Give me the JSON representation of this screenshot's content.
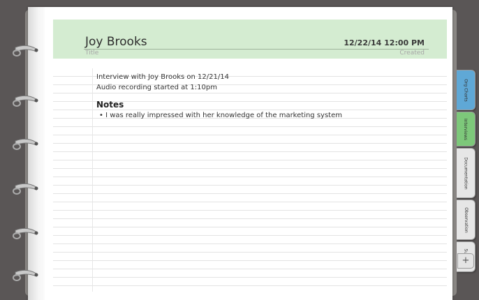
{
  "note": {
    "title": "Joy Brooks",
    "title_caption": "Title",
    "created": "12/22/14 12:00 PM",
    "created_caption": "Created"
  },
  "body": {
    "line1": "Interview with Joy Brooks on 12/21/14",
    "line2": "Audio recording started at 1:10pm",
    "heading": "Notes",
    "bullet1": "•  I was really impressed with her knowledge of the marketing system"
  },
  "tabs": [
    {
      "label": "Org Charts",
      "color": "#5fa8d6"
    },
    {
      "label": "Interviews",
      "color": "#7dc87a"
    },
    {
      "label": "Documentation",
      "color": "#e6e6e6"
    },
    {
      "label": "Observation",
      "color": "#e6e6e6"
    },
    {
      "label": "Surveys",
      "color": "#e6e6e6"
    }
  ],
  "add_tab_label": "+",
  "colors": {
    "header_bg": "#d4ecd1",
    "background": "#5a5656"
  }
}
